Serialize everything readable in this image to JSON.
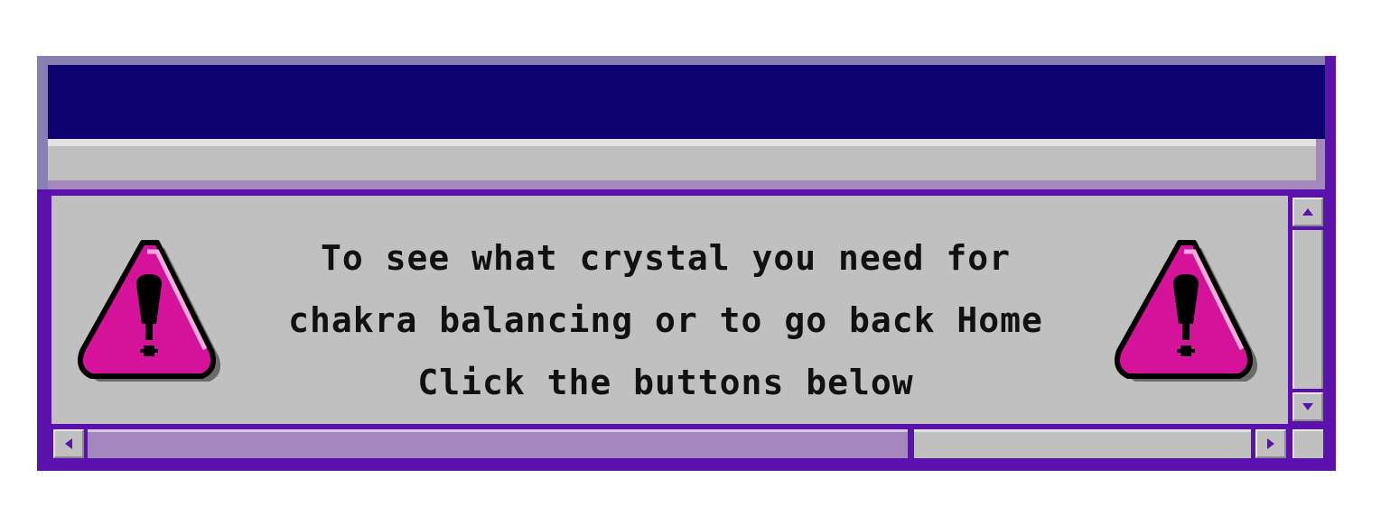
{
  "dialog": {
    "title": "",
    "message_lines": [
      "To see what crystal you need for",
      "chakra balancing or to go back Home",
      "Click the buttons below"
    ]
  },
  "icons": {
    "warning": "warning-triangle-icon",
    "scroll_up": "arrow-up-icon",
    "scroll_down": "arrow-down-icon",
    "scroll_left": "arrow-left-icon",
    "scroll_right": "arrow-right-icon"
  },
  "colors": {
    "titlebar": "#0d006f",
    "frame": "#5b12ad",
    "panel": "#c0c0c0",
    "warning_fill": "#d4139a",
    "scroll_thumb": "#a487bd"
  },
  "scrollbar": {
    "horizontal_position": 0.0,
    "horizontal_visible_fraction": 0.66
  }
}
